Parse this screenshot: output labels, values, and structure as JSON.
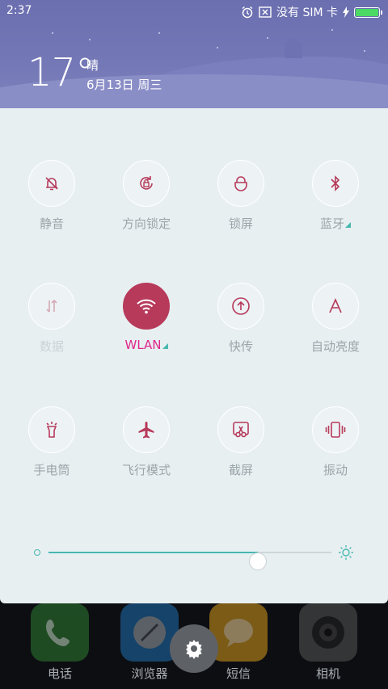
{
  "status_bar": {
    "time": "2:37",
    "carrier": "没有 SIM 卡",
    "battery_level": 1.0,
    "icons": [
      "alarm-icon",
      "sim-x-icon",
      "charging-icon",
      "battery-icon"
    ]
  },
  "weather": {
    "temperature": "17°",
    "condition": "晴",
    "date": "6月13日 周三"
  },
  "toggles": [
    {
      "id": "mute",
      "label": "静音",
      "icon": "bell-off-icon",
      "state": "off"
    },
    {
      "id": "rotation-lock",
      "label": "方向锁定",
      "icon": "rotation-lock-icon",
      "state": "off"
    },
    {
      "id": "lock-screen",
      "label": "锁屏",
      "icon": "lock-icon",
      "state": "off"
    },
    {
      "id": "bluetooth",
      "label": "蓝牙",
      "icon": "bluetooth-icon",
      "state": "off",
      "has_more": true
    },
    {
      "id": "data",
      "label": "数据",
      "icon": "data-arrows-icon",
      "state": "disabled"
    },
    {
      "id": "wlan",
      "label": "WLAN",
      "icon": "wifi-icon",
      "state": "on",
      "has_more": true
    },
    {
      "id": "quick-share",
      "label": "快传",
      "icon": "upload-icon",
      "state": "off"
    },
    {
      "id": "auto-brightness",
      "label": "自动亮度",
      "icon": "auto-a-icon",
      "state": "off"
    },
    {
      "id": "flashlight",
      "label": "手电筒",
      "icon": "flashlight-icon",
      "state": "off"
    },
    {
      "id": "airplane",
      "label": "飞行模式",
      "icon": "airplane-icon",
      "state": "off"
    },
    {
      "id": "screenshot",
      "label": "截屏",
      "icon": "scissors-icon",
      "state": "off"
    },
    {
      "id": "vibrate",
      "label": "振动",
      "icon": "vibrate-icon",
      "state": "off"
    }
  ],
  "brightness": {
    "level": 0.74
  },
  "dock": {
    "apps": [
      {
        "label": "电话",
        "icon": "phone-icon",
        "color": "#2e7d32"
      },
      {
        "label": "浏览器",
        "icon": "browser-icon",
        "color": "#1e6fb0"
      },
      {
        "label": "短信",
        "icon": "sms-icon",
        "color": "#d89a1a"
      },
      {
        "label": "相机",
        "icon": "camera-icon",
        "color": "#555555"
      }
    ]
  },
  "colors": {
    "accent": "#b73a5b",
    "teal": "#47b8b0",
    "panel_bg": "#e8eff1",
    "active_label": "#e0268c"
  }
}
